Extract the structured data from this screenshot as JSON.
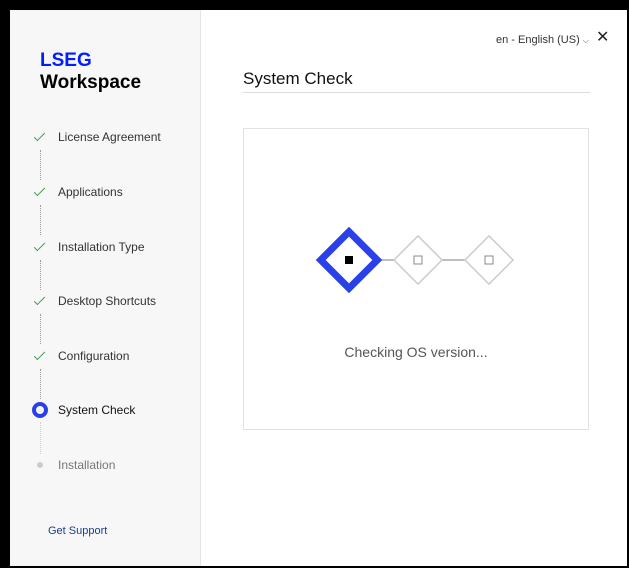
{
  "app": {
    "brand": "LSEG",
    "product": "Workspace"
  },
  "header": {
    "language": "en - English (US)",
    "close_glyph": "✕"
  },
  "sidebar": {
    "steps": [
      {
        "label": "License Agreement",
        "state": "done"
      },
      {
        "label": "Applications",
        "state": "done"
      },
      {
        "label": "Installation Type",
        "state": "done"
      },
      {
        "label": "Desktop Shortcuts",
        "state": "done"
      },
      {
        "label": "Configuration",
        "state": "done"
      },
      {
        "label": "System Check",
        "state": "active"
      },
      {
        "label": "Installation",
        "state": "pending"
      }
    ],
    "support_label": "Get Support"
  },
  "main": {
    "title": "System Check",
    "status": "Checking OS version...",
    "checks_total": 3,
    "current_check": 1
  },
  "colors": {
    "accent": "#2a40e8",
    "done_check": "#3f9c56",
    "inactive_diamond": "#cccccc"
  }
}
